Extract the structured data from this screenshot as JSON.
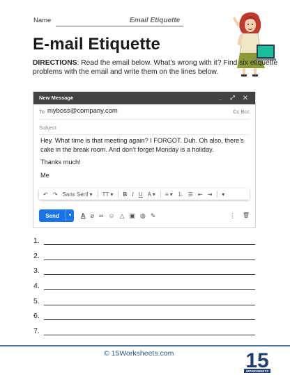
{
  "header": {
    "name_label": "Name",
    "worksheet_title": "Email Etiquette"
  },
  "title": "E-mail Etiquette",
  "directions": {
    "label": "DIRECTIONS",
    "text": ": Read the email below. What’s wrong with it? Find six etiquette problems with the email and write them on the lines below."
  },
  "email": {
    "window_title": "New Message",
    "window_controls": "_ ⤢ ✕",
    "to_label": "To",
    "to_value": "myboss@company.com",
    "cc_bcc": "Cc Bcc",
    "subject_placeholder": "Subject",
    "body": [
      "Hey. What time is that meeting again? I FORGOT. Duh. Oh also, there’s cake in the break room. And don’t forget Monday is a holiday.",
      "Thanks much!",
      "Me"
    ],
    "toolbar": {
      "undo": "↶",
      "redo": "↷",
      "font": "Sans Serif ▾",
      "size": "TT ▾",
      "bold": "B",
      "italic": "I",
      "underline": "U",
      "text_color": "A ▾",
      "align": "≡ ▾",
      "numbered": "⒈",
      "bullets": "☰",
      "indent_less": "⇤",
      "indent_more": "⇥",
      "more": "▾"
    },
    "send_label": "Send",
    "bottom_icons": [
      "A",
      "⌀",
      "∞",
      "☺",
      "△",
      "▣",
      "◍",
      "✎"
    ],
    "more_icon": "⋮",
    "trash_icon": "🗑"
  },
  "answer_lines": [
    "1.",
    "2.",
    "3.",
    "4.",
    "5.",
    "6.",
    "7."
  ],
  "footer": {
    "text": "© 15Worksheets.com",
    "logo_text": "15",
    "logo_sub": "WORKSHEETS"
  },
  "colors": {
    "accent": "#1a73e8",
    "footer": "#2b5a85",
    "header_bar": "#424242"
  }
}
